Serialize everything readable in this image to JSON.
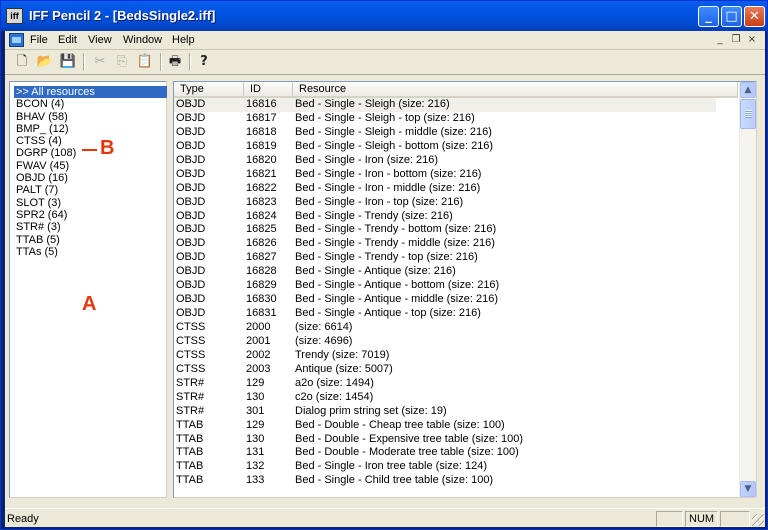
{
  "window": {
    "title": "IFF Pencil 2 - [BedsSingle2.iff]",
    "app_icon_text": "iff",
    "minimize": "_",
    "maximize": "□",
    "close": "✕"
  },
  "menu": {
    "items": [
      "File",
      "Edit",
      "View",
      "Window",
      "Help"
    ],
    "mdi_minimize": "_",
    "mdi_restore": "❐",
    "mdi_close": "×"
  },
  "toolbar": {
    "tools": [
      {
        "name": "new-icon",
        "glyph": "🗋",
        "enabled": true
      },
      {
        "name": "open-icon",
        "glyph": "📂",
        "enabled": true
      },
      {
        "name": "save-icon",
        "glyph": "💾",
        "enabled": true
      },
      {
        "name": "cut-icon",
        "glyph": "✂",
        "enabled": false
      },
      {
        "name": "copy-icon",
        "glyph": "⎘",
        "enabled": false
      },
      {
        "name": "paste-icon",
        "glyph": "📋",
        "enabled": false
      },
      {
        "name": "print-icon",
        "glyph": "🖶",
        "enabled": true
      },
      {
        "name": "help-icon",
        "glyph": "?",
        "enabled": true
      }
    ]
  },
  "left": {
    "items": [
      ">> All resources",
      "BCON (4)",
      "BHAV (58)",
      "BMP_ (12)",
      "CTSS (4)",
      "DGRP (108)",
      "FWAV (45)",
      "OBJD (16)",
      "PALT (7)",
      "SLOT (3)",
      "SPR2 (64)",
      "STR# (3)",
      "TTAB (5)",
      "TTAs (5)"
    ],
    "annotation_a": "A",
    "annotation_b": "B"
  },
  "list": {
    "columns": [
      "Type",
      "ID",
      "Resource"
    ],
    "rows": [
      [
        "OBJD",
        "16816",
        "Bed - Single - Sleigh (size: 216)"
      ],
      [
        "OBJD",
        "16817",
        "Bed - Single - Sleigh - top (size: 216)"
      ],
      [
        "OBJD",
        "16818",
        "Bed - Single - Sleigh - middle (size: 216)"
      ],
      [
        "OBJD",
        "16819",
        "Bed - Single - Sleigh - bottom (size: 216)"
      ],
      [
        "OBJD",
        "16820",
        "Bed - Single - Iron (size: 216)"
      ],
      [
        "OBJD",
        "16821",
        "Bed - Single - Iron - bottom (size: 216)"
      ],
      [
        "OBJD",
        "16822",
        "Bed - Single - Iron - middle (size: 216)"
      ],
      [
        "OBJD",
        "16823",
        "Bed - Single - Iron - top (size: 216)"
      ],
      [
        "OBJD",
        "16824",
        "Bed - Single - Trendy (size: 216)"
      ],
      [
        "OBJD",
        "16825",
        "Bed - Single - Trendy - bottom (size: 216)"
      ],
      [
        "OBJD",
        "16826",
        "Bed - Single - Trendy - middle (size: 216)"
      ],
      [
        "OBJD",
        "16827",
        "Bed - Single - Trendy - top (size: 216)"
      ],
      [
        "OBJD",
        "16828",
        "Bed - Single - Antique (size: 216)"
      ],
      [
        "OBJD",
        "16829",
        "Bed - Single - Antique - bottom (size: 216)"
      ],
      [
        "OBJD",
        "16830",
        "Bed - Single - Antique - middle (size: 216)"
      ],
      [
        "OBJD",
        "16831",
        "Bed - Single - Antique - top (size: 216)"
      ],
      [
        "CTSS",
        "2000",
        " (size: 6614)"
      ],
      [
        "CTSS",
        "2001",
        " (size: 4696)"
      ],
      [
        "CTSS",
        "2002",
        "Trendy (size: 7019)"
      ],
      [
        "CTSS",
        "2003",
        "Antique (size: 5007)"
      ],
      [
        "STR#",
        "129",
        "a2o (size: 1494)"
      ],
      [
        "STR#",
        "130",
        "c2o (size: 1454)"
      ],
      [
        "STR#",
        "301",
        "Dialog prim string set (size: 19)"
      ],
      [
        "TTAB",
        "129",
        "Bed - Double - Cheap tree table (size: 100)"
      ],
      [
        "TTAB",
        "130",
        "Bed - Double - Expensive tree table (size: 100)"
      ],
      [
        "TTAB",
        "131",
        "Bed - Double - Moderate tree table (size: 100)"
      ],
      [
        "TTAB",
        "132",
        "Bed - Single - Iron tree table (size: 124)"
      ],
      [
        "TTAB",
        "133",
        "Bed - Single - Child tree table (size: 100)"
      ]
    ],
    "scroll_up": "▲",
    "scroll_down": "▼"
  },
  "status": {
    "text": "Ready",
    "num": "NUM"
  },
  "colors": {
    "selection": "#316ac5",
    "annotation": "#e8360c",
    "titlebar": "#0054e3"
  }
}
